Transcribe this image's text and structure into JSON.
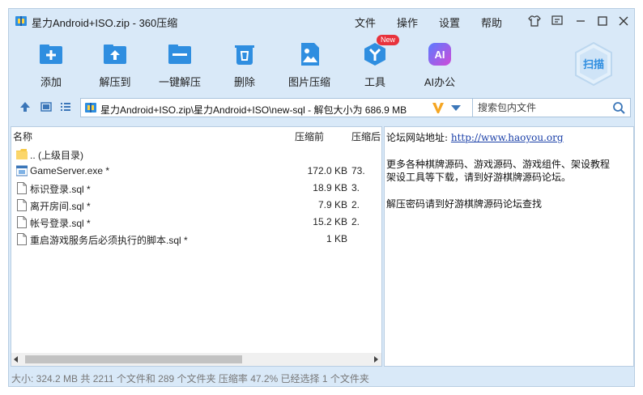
{
  "window": {
    "title": "星力Android+ISO.zip - 360压缩",
    "menus": [
      "文件",
      "操作",
      "设置",
      "帮助"
    ]
  },
  "toolbar": {
    "buttons": [
      {
        "label": "添加",
        "icon": "add-icon"
      },
      {
        "label": "解压到",
        "icon": "extract-to-icon"
      },
      {
        "label": "一键解压",
        "icon": "one-click-extract-icon"
      },
      {
        "label": "删除",
        "icon": "delete-icon"
      },
      {
        "label": "图片压缩",
        "icon": "image-compress-icon"
      },
      {
        "label": "工具",
        "icon": "tools-icon"
      },
      {
        "label": "AI办公",
        "icon": "ai-office-icon"
      }
    ],
    "new_badge": "New",
    "ai_text": "AI",
    "scan_label": "扫描"
  },
  "address": {
    "path": "星力Android+ISO.zip\\星力Android+ISO\\new-sql - 解包大小为 686.9 MB"
  },
  "search": {
    "placeholder": "搜索包内文件"
  },
  "file_list": {
    "columns": [
      "名称",
      "压缩前",
      "压缩后"
    ],
    "rows": [
      {
        "name": ".. (上级目录)",
        "size": "",
        "compressed": "",
        "icon": "folder-up-icon"
      },
      {
        "name": "GameServer.exe *",
        "size": "172.0 KB",
        "compressed": "73.",
        "icon": "exe-file-icon"
      },
      {
        "name": "标识登录.sql *",
        "size": "18.9 KB",
        "compressed": "3.",
        "icon": "file-icon"
      },
      {
        "name": "离开房间.sql *",
        "size": "7.9 KB",
        "compressed": "2.",
        "icon": "file-icon"
      },
      {
        "name": "帐号登录.sql *",
        "size": "15.2 KB",
        "compressed": "2.",
        "icon": "file-icon"
      },
      {
        "name": "重启游戏服务后必须执行的脚本.sql *",
        "size": "1 KB",
        "compressed": "",
        "icon": "file-icon"
      }
    ]
  },
  "comment": {
    "line1_prefix": "论坛网站地址:",
    "line1_link": "http://www.haoyou.org",
    "line2": "更多各种棋牌源码、游戏源码、游戏组件、架设教程",
    "line3": "架设工具等下载，请到好游棋牌源码论坛。",
    "line4": "解压密码请到好游棋牌源码论坛查找"
  },
  "status": {
    "text": "大小: 324.2 MB 共 2211 个文件和 289 个文件夹 压缩率 47.2% 已经选择 1 个文件夹"
  },
  "colors": {
    "window_bg": "#d9e9f8",
    "accent_blue": "#2f8ee0",
    "badge_red": "#e8323c"
  }
}
